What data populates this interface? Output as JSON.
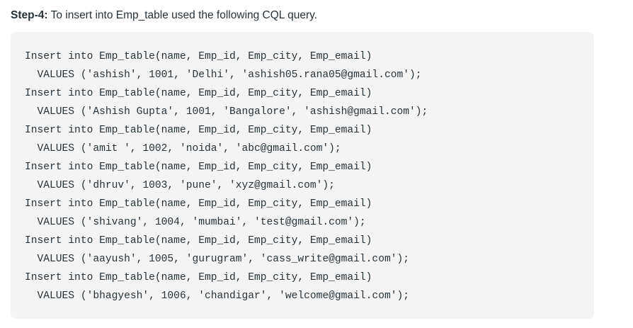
{
  "step": {
    "label": "Step-4:",
    "text": " To insert into Emp_table used the following CQL query."
  },
  "code": {
    "lines": [
      "Insert into Emp_table(name, Emp_id, Emp_city, Emp_email)",
      "  VALUES ('ashish', 1001, 'Delhi', 'ashish05.rana05@gmail.com');",
      "Insert into Emp_table(name, Emp_id, Emp_city, Emp_email)",
      "  VALUES ('Ashish Gupta', 1001, 'Bangalore', 'ashish@gmail.com');",
      "Insert into Emp_table(name, Emp_id, Emp_city, Emp_email)",
      "  VALUES ('amit ', 1002, 'noida', 'abc@gmail.com');",
      "Insert into Emp_table(name, Emp_id, Emp_city, Emp_email)",
      "  VALUES ('dhruv', 1003, 'pune', 'xyz@gmail.com');",
      "Insert into Emp_table(name, Emp_id, Emp_city, Emp_email)",
      "  VALUES ('shivang', 1004, 'mumbai', 'test@gmail.com');",
      "Insert into Emp_table(name, Emp_id, Emp_city, Emp_email)",
      "  VALUES ('aayush', 1005, 'gurugram', 'cass_write@gmail.com');",
      "Insert into Emp_table(name, Emp_id, Emp_city, Emp_email)",
      "  VALUES ('bhagyesh', 1006, 'chandigar', 'welcome@gmail.com');"
    ]
  },
  "colors": {
    "text": "#273239",
    "code_background": "#f4f4f4",
    "page_background": "#ffffff"
  }
}
